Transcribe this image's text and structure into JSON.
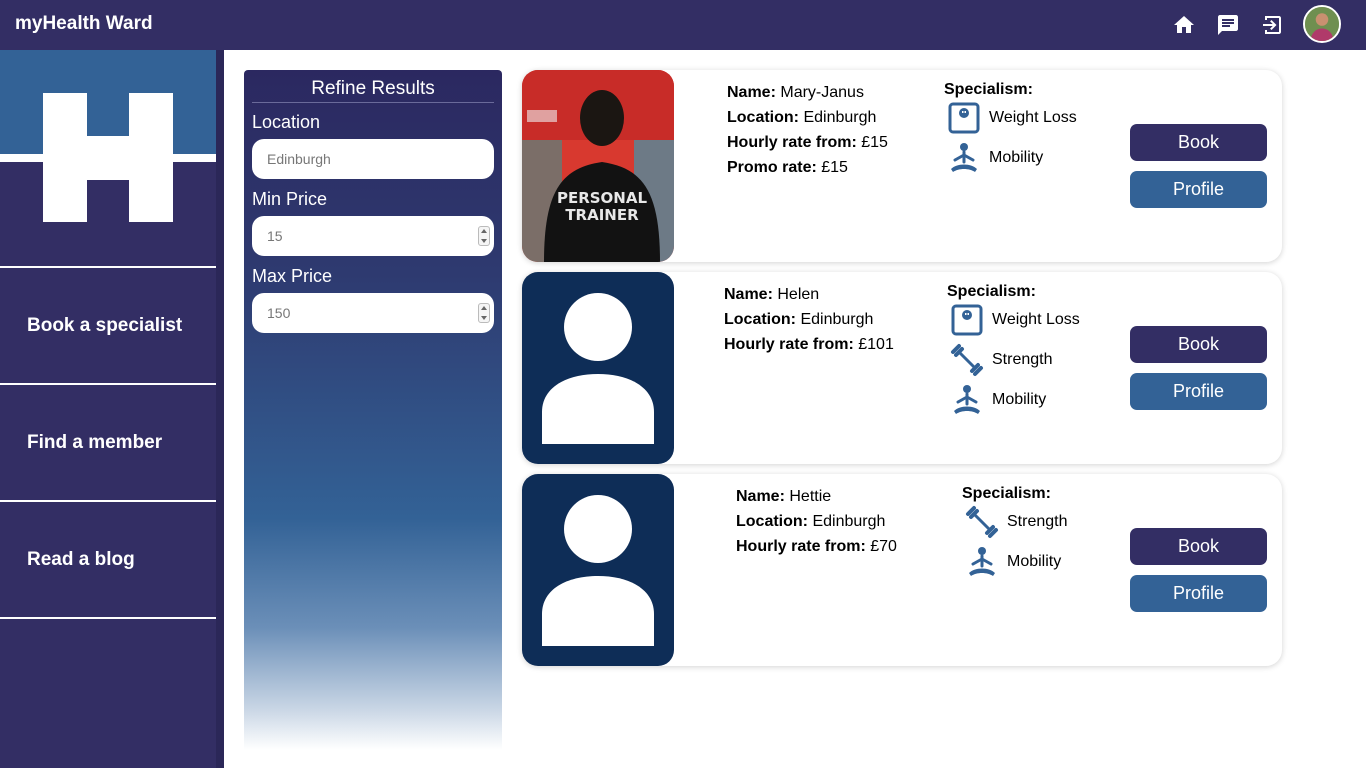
{
  "app": {
    "title": "myHealth Ward"
  },
  "header": {
    "icons": [
      "home-icon",
      "chat-icon",
      "logout-icon"
    ],
    "avatar": "user-avatar"
  },
  "sidebar": {
    "logo": "H",
    "items": [
      {
        "label": "Book a specialist"
      },
      {
        "label": "Find a member"
      },
      {
        "label": "Read a blog"
      }
    ]
  },
  "refine": {
    "title": "Refine Results",
    "location_label": "Location",
    "location_placeholder": "Edinburgh",
    "min_label": "Min Price",
    "min_placeholder": "15",
    "max_label": "Max Price",
    "max_placeholder": "150"
  },
  "labels": {
    "name": "Name:",
    "location": "Location:",
    "hourly": "Hourly rate from:",
    "promo": "Promo rate:",
    "specialism": "Specialism:",
    "book": "Book",
    "profile": "Profile"
  },
  "specialists": [
    {
      "name": "Mary-Janus",
      "location": "Edinburgh",
      "hourly": "£15",
      "promo": "£15",
      "photo": "personal-trainer-photo",
      "photo_text": [
        "PERSONAL",
        "TRAINER"
      ],
      "specialisms": [
        "Weight Loss",
        "Mobility"
      ]
    },
    {
      "name": "Helen",
      "location": "Edinburgh",
      "hourly": "£101",
      "photo": "default-avatar",
      "specialisms": [
        "Weight Loss",
        "Strength",
        "Mobility"
      ]
    },
    {
      "name": "Hettie",
      "location": "Edinburgh",
      "hourly": "£70",
      "photo": "default-avatar",
      "specialisms": [
        "Strength",
        "Mobility"
      ]
    }
  ],
  "colors": {
    "primary": "#332e64",
    "secondary": "#336296",
    "avatar_bg": "#0e2d57"
  }
}
